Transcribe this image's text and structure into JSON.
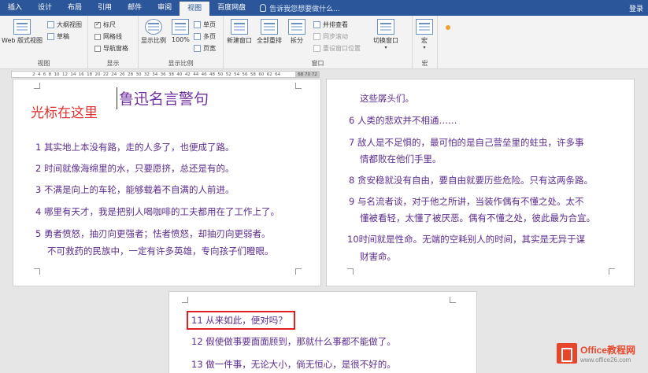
{
  "tabs": [
    "插入",
    "设计",
    "布局",
    "引用",
    "邮件",
    "审阅",
    "视图",
    "百度网盘"
  ],
  "active_tab": "视图",
  "tell_me": "告诉我您想要做什么...",
  "login": "登录",
  "ribbon": {
    "views": {
      "web_layout": "Web 版式视图",
      "outline": "大纲视图",
      "draft": "草稿",
      "label": "视图"
    },
    "show": {
      "ruler": "标尺",
      "gridlines": "网格线",
      "nav_pane": "导航窗格",
      "label": "显示"
    },
    "zoom": {
      "zoom": "显示比例",
      "hundred": "100%",
      "one_page": "单页",
      "multi_page": "多页",
      "page_width": "页宽",
      "label": "显示比例"
    },
    "window": {
      "new_window": "新建窗口",
      "arrange_all": "全部重排",
      "split": "拆分",
      "side_by_side": "并排查看",
      "sync_scroll": "同步滚动",
      "reset_pos": "重设窗口位置",
      "switch": "切换窗口",
      "label": "窗口"
    },
    "macros": {
      "macro": "宏",
      "label": "宏"
    }
  },
  "ruler": {
    "ticks": [
      "2",
      "4",
      "6",
      "8",
      "10",
      "12",
      "14",
      "16",
      "18",
      "20",
      "22",
      "24",
      "26",
      "28",
      "30",
      "32",
      "34",
      "36",
      "38",
      "40",
      "42",
      "44",
      "46",
      "48",
      "50",
      "52",
      "54",
      "56",
      "58",
      "60",
      "62",
      "64"
    ],
    "end": "68  70  72"
  },
  "page1": {
    "title": "鲁迅名言警句",
    "annotation": "光标在这里",
    "items": [
      {
        "num": "1",
        "text": "其实地上本没有路，走的人多了，也便成了路。"
      },
      {
        "num": "2",
        "text": "时间就像海绵里的水，只要愿挤，总还是有的。"
      },
      {
        "num": "3",
        "text": "不满是向上的车轮，能够载着不自满的人前进。"
      },
      {
        "num": "4",
        "text": "哪里有天才，我是把别人喝咖啡的工夫都用在了工作上了。"
      },
      {
        "num": "5",
        "text": "勇者愤怒，抽刃向更强者；怯者愤怒，却抽刃向更弱者。",
        "cont": "不可救药的民族中，一定有许多英雄，专向孩子们瞪眼。"
      }
    ]
  },
  "page2": {
    "lead": "这些孱头们。",
    "items": [
      {
        "num": "6",
        "text": "人类的悲欢并不相通……"
      },
      {
        "num": "7",
        "text": "敌人是不足惧的，最可怕的是自己营垒里的蛀虫，许多事",
        "cont": "情都败在他们手里。"
      },
      {
        "num": "8",
        "text": "贪安稳就没有自由，要自由就要历些危险。只有这两条路。"
      },
      {
        "num": "9",
        "text": "与名流者谈，对于他之所讲，当装作偶有不懂之处。太不",
        "cont": "懂被看轻，太懂了被厌恶。偶有不懂之处，彼此最为合宜。"
      },
      {
        "num": "10",
        "text": "时间就是性命。无端的空耗别人的时间，其实是无异于谋",
        "cont": "财害命。"
      }
    ]
  },
  "page3": {
    "items": [
      {
        "num": "11",
        "text": "从来如此，便对吗？"
      },
      {
        "num": "12",
        "text": "假使做事要面面顾到，那就什么事都不能做了。"
      },
      {
        "num": "13",
        "text": "做一件事，无论大小，倘无恒心，是很不好的。"
      }
    ]
  },
  "watermark": {
    "main": "Office教程网",
    "sub": "www.office26.com"
  },
  "colors": {
    "tabbar": "#2b579a",
    "doc_text": "#5b2d8e",
    "title": "#7030a0",
    "annotation": "#e03030",
    "highlight_box": "#e02020"
  }
}
